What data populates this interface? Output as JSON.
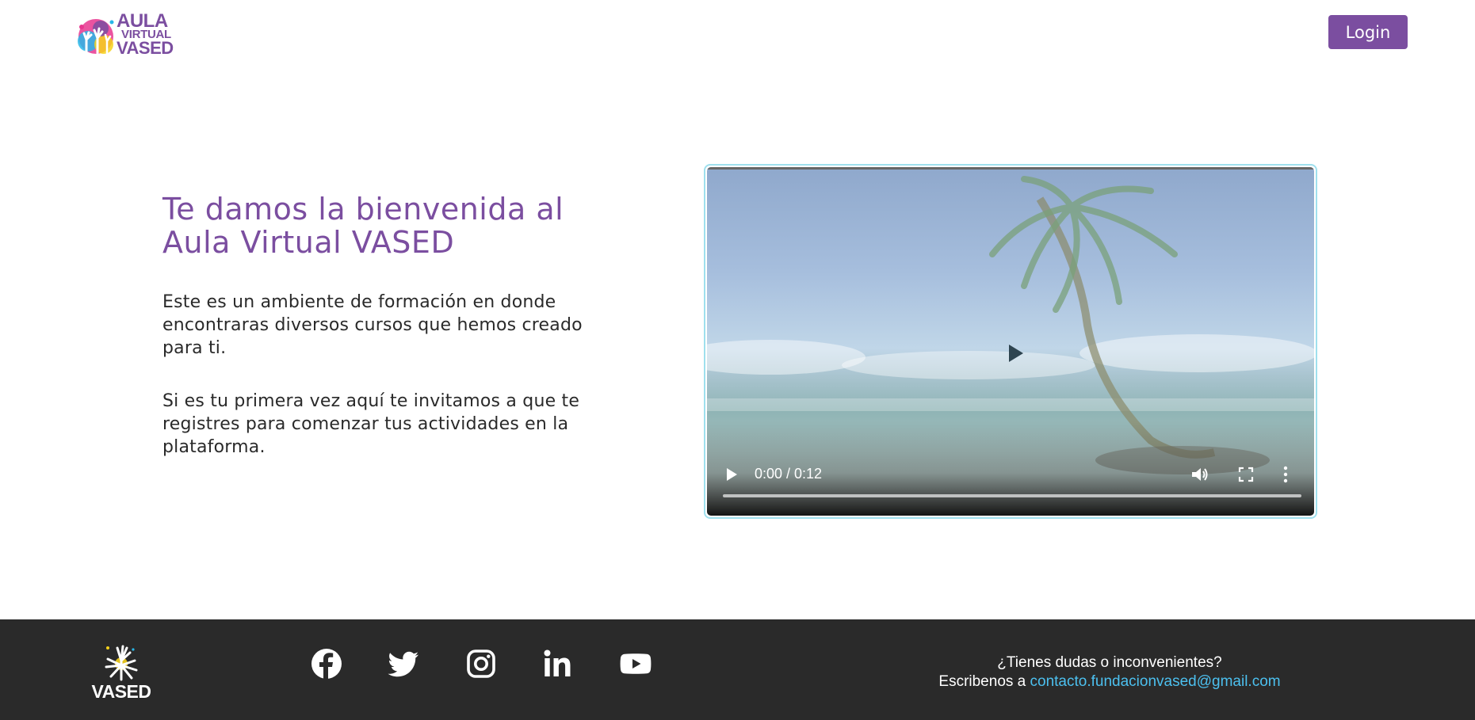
{
  "header": {
    "logo": {
      "line1": "AULA",
      "line2": "VIRTUAL",
      "line3": "VASED",
      "icon": "hands-logo-icon"
    },
    "login_label": "Login"
  },
  "hero": {
    "title": "Te damos la bienvenida al Aula Virtual VASED",
    "paragraph1": "Este es un ambiente de formación en donde encontraras diversos cursos que hemos creado para ti.",
    "paragraph2": "Si es tu primera vez aquí te invitamos a que te registres para comenzar tus actividades en la plataforma."
  },
  "video": {
    "time": "0:00 / 0:12",
    "progress": 0,
    "icons": [
      "play-icon",
      "volume-icon",
      "fullscreen-icon",
      "more-options-icon"
    ]
  },
  "footer": {
    "logo_text": "VASED",
    "social": [
      "facebook-icon",
      "twitter-icon",
      "instagram-icon",
      "linkedin-icon",
      "youtube-icon"
    ],
    "question": "¿Tienes dudas o inconvenientes?",
    "write_prefix": "Escribenos a",
    "email": "contacto.fundacionvased@gmail.com"
  },
  "colors": {
    "brand_purple": "#7b4ea0",
    "footer_bg": "#2a2a2a",
    "link_blue": "#4cc0ef",
    "video_border": "#9fe0ee"
  }
}
